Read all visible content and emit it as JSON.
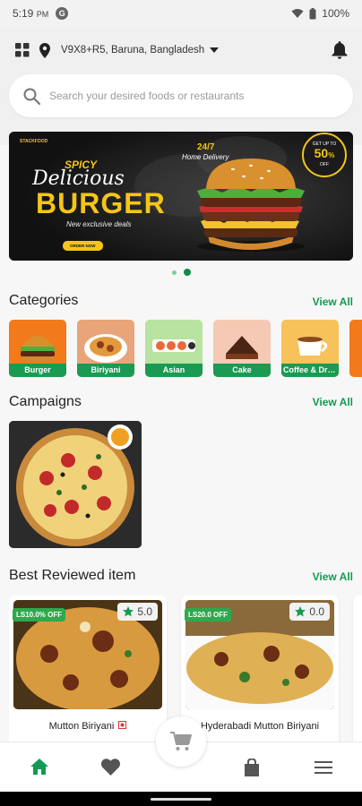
{
  "status_bar": {
    "time": "5:19",
    "ampm": "PM",
    "battery": "100%"
  },
  "header": {
    "location": "V9X8+R5, Baruna, Bangladesh"
  },
  "search": {
    "placeholder": "Search your desired foods or restaurants"
  },
  "banner": {
    "brand": "STACKFOOD",
    "line1": "SPICY",
    "line2": "Delicious",
    "line3": "BURGER",
    "tagline": "New exclusive deals",
    "cta": "ORDER NOW",
    "delivery_top": "24/7",
    "delivery_bottom": "Home Delivery",
    "badge_top": "GET UP TO",
    "badge_value": "50",
    "badge_unit": "%",
    "badge_bottom": "OFF"
  },
  "categories": {
    "title": "Categories",
    "view_all": "View All",
    "items": [
      {
        "label": "Burger"
      },
      {
        "label": "Biriyani"
      },
      {
        "label": "Asian"
      },
      {
        "label": "Cake"
      },
      {
        "label": "Coffee & Drinks"
      }
    ]
  },
  "campaigns": {
    "title": "Campaigns",
    "view_all": "View All"
  },
  "best_reviewed": {
    "title": "Best Reviewed item",
    "view_all": "View All",
    "items": [
      {
        "name": "Mutton Biriyani",
        "discount": "LS10.0% OFF",
        "rating": "5.0"
      },
      {
        "name": "Hyderabadi Mutton Biriyani",
        "discount": "LS20.0 OFF",
        "rating": "0.0"
      }
    ]
  },
  "colors": {
    "accent": "#119b53",
    "label_bg": "#1a9a52",
    "banner_yellow": "#f5c518"
  },
  "icons": [
    "grid-icon",
    "location-pin-icon",
    "dropdown-icon",
    "bell-icon",
    "search-icon",
    "home-icon",
    "heart-icon",
    "cart-icon",
    "bag-icon",
    "menu-icon"
  ]
}
